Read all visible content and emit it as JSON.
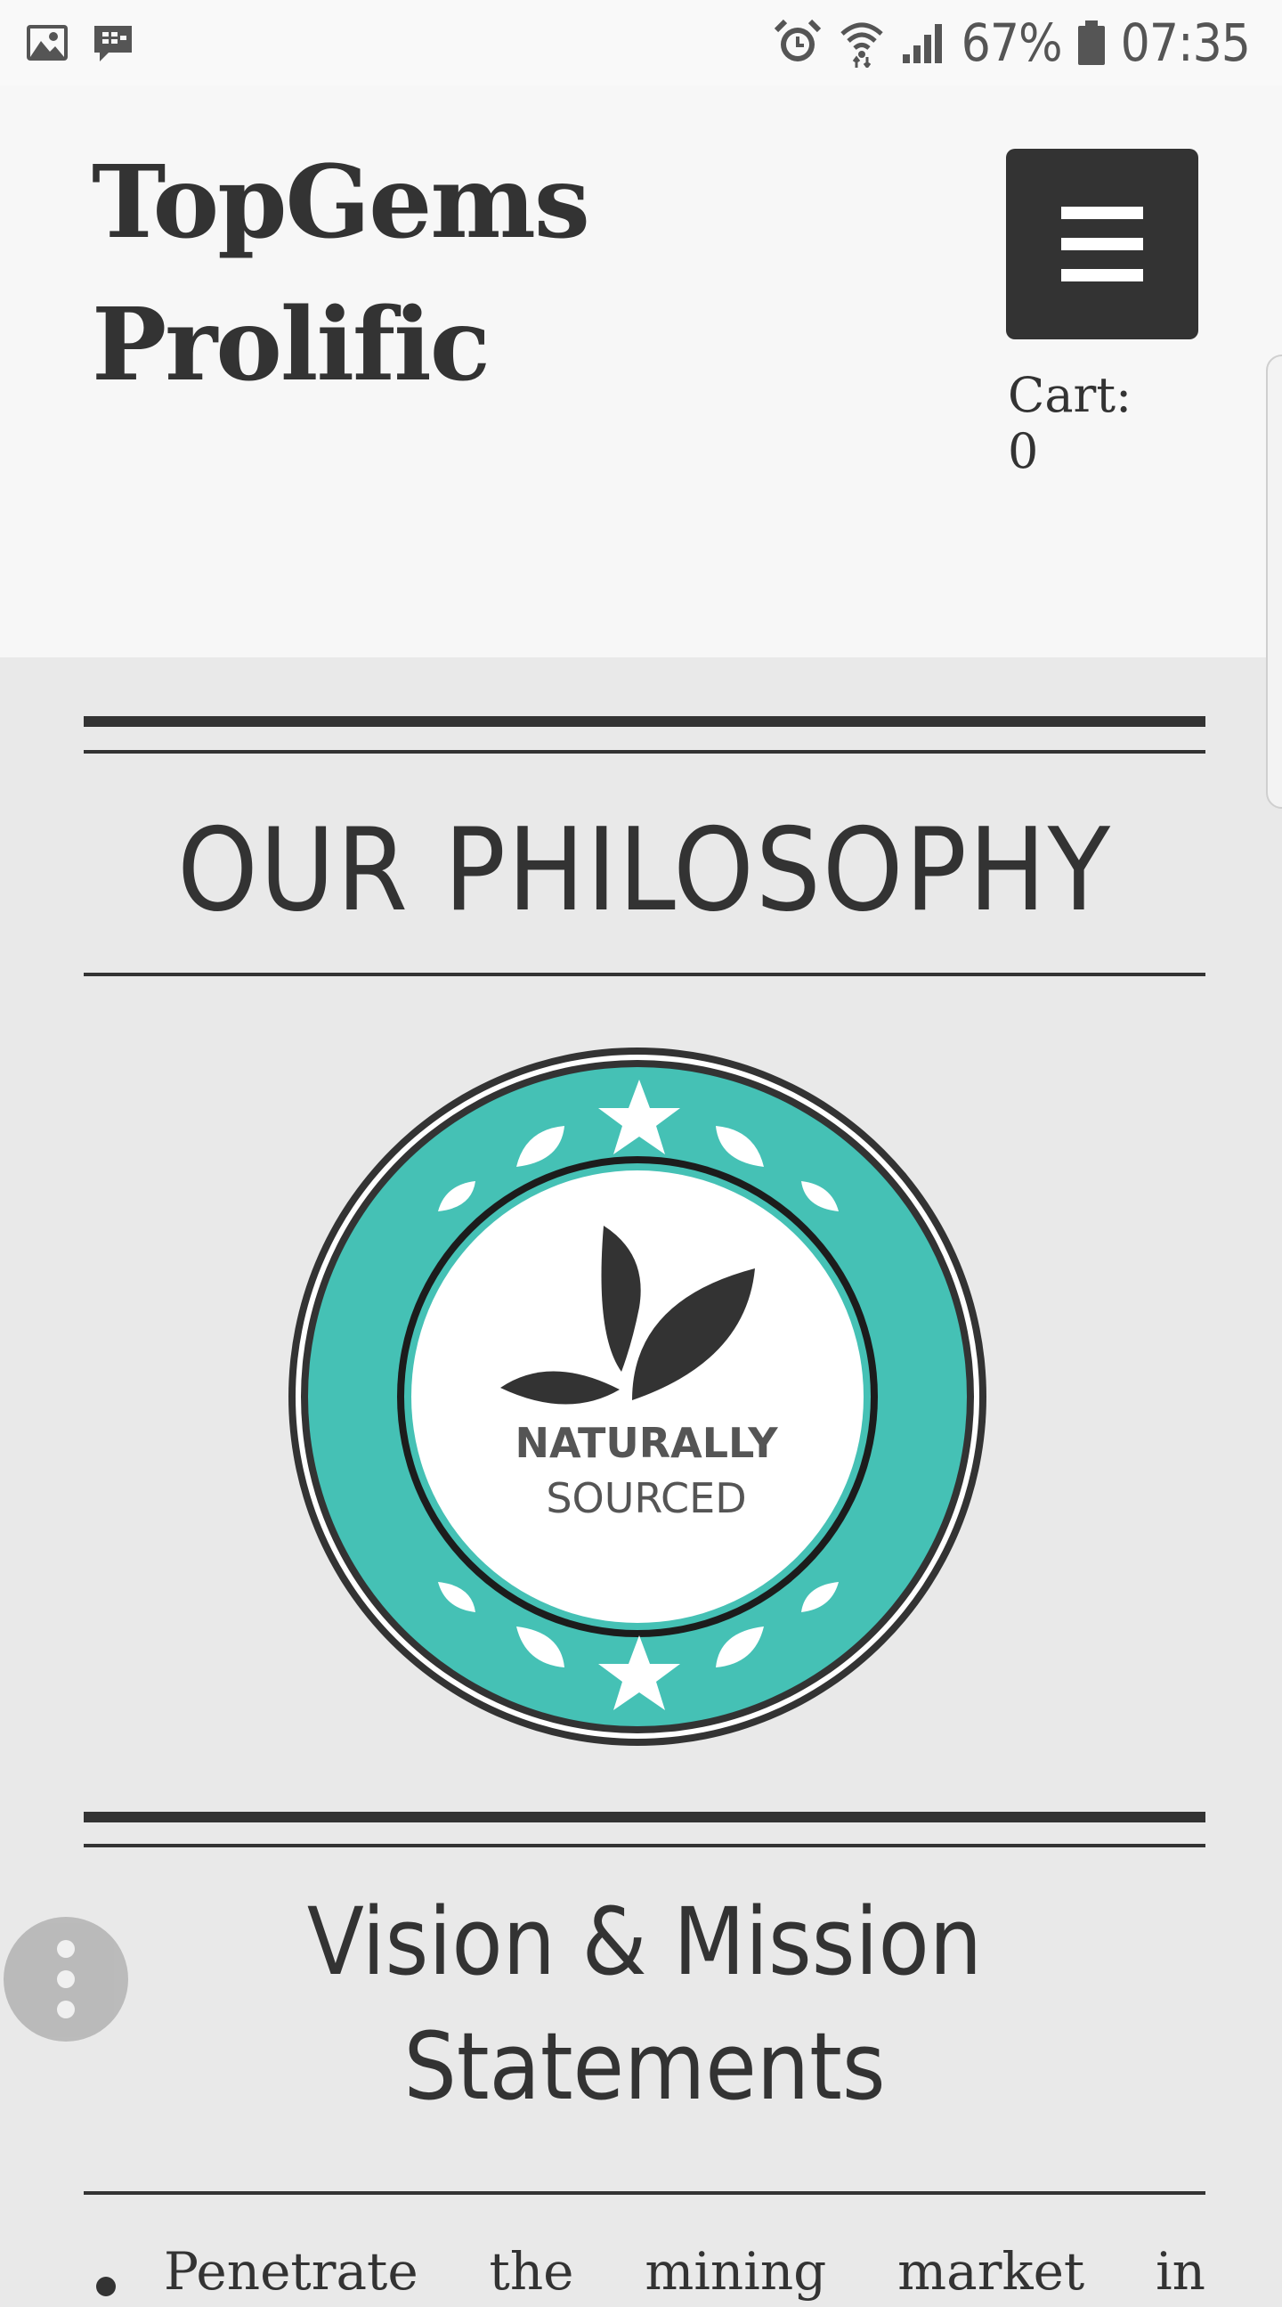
{
  "status_bar": {
    "left_icons": [
      "gallery-icon",
      "bbm-icon"
    ],
    "right_icons": [
      "alarm-icon",
      "wifi-icon",
      "signal-icon",
      "battery-icon"
    ],
    "battery": "67%",
    "time": "07:35"
  },
  "header": {
    "brand_line1": "TopGems",
    "brand_line2": "Prolific",
    "menu_icon": "hamburger-icon",
    "cart_label": "Cart: 0"
  },
  "philosophy": {
    "title": "OUR PHILOSOPHY",
    "badge": {
      "line1": "NATURALLY",
      "line2": "SOURCED",
      "ring_color": "#45c1b5",
      "icon": "leaves-icon"
    }
  },
  "vision": {
    "title_line1": "Vision & Mission",
    "title_line2": "Statements",
    "items": [
      "Penetrate the mining market in"
    ]
  },
  "floating_button": {
    "icon": "more-vertical-icon"
  },
  "colors": {
    "text": "#333333",
    "page_background": "#e9e9e9",
    "header_background": "#f7f7f7",
    "accent": "#45c1b5"
  }
}
